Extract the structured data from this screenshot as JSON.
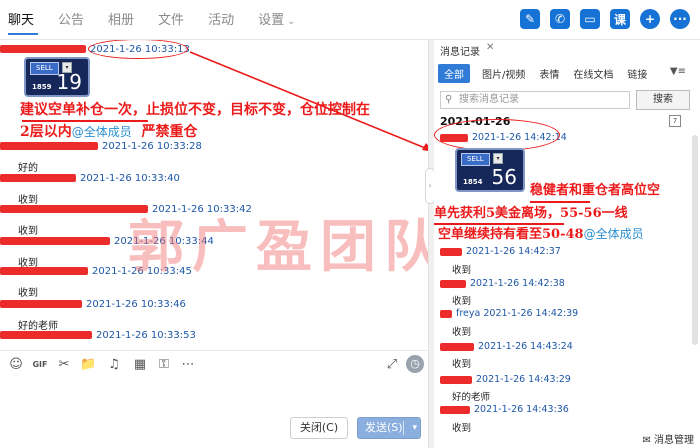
{
  "tabs": [
    {
      "label": "聊天"
    },
    {
      "label": "公告"
    },
    {
      "label": "相册"
    },
    {
      "label": "文件"
    },
    {
      "label": "活动"
    },
    {
      "label": "设置"
    }
  ],
  "top_icons": {
    "ke": "课",
    "plus": "+",
    "more": "···"
  },
  "chat": {
    "msg0_time": "2021-1-26 10:33:13",
    "card0": {
      "label": "SELL",
      "small": "1859",
      "big": "19"
    },
    "ann1_line1": "建议空单补仓一次，止损位不变，目标不变，仓位控制在",
    "ann1_line2_red": "2层以内",
    "ann1_line2_blue": "@全体成员",
    "ann1_line2_tail": "严禁重仓",
    "messages": [
      {
        "time": "2021-1-26 10:33:28",
        "text": "好的"
      },
      {
        "time": "2021-1-26 10:33:40",
        "text": "收到"
      },
      {
        "time": "2021-1-26 10:33:42",
        "text": "收到"
      },
      {
        "time": "2021-1-26 10:33:44",
        "text": "收到"
      },
      {
        "time": "2021-1-26 10:33:45",
        "text": "收到"
      },
      {
        "time": "2021-1-26 10:33:46",
        "text": "好的老师"
      },
      {
        "time": "2021-1-26 10:33:53",
        "text": "收到"
      }
    ],
    "watermark": "郭广盈团队"
  },
  "composer": {
    "close_label": "关闭(C)",
    "send_label": "发送(S)"
  },
  "history": {
    "title": "消息记录",
    "tabs": [
      "全部",
      "图片/视频",
      "表情",
      "在线文档",
      "链接"
    ],
    "search_placeholder": "搜索消息记录",
    "search_button": "搜索",
    "date": "2021-01-26",
    "first_time": "2021-1-26 14:42:14",
    "card1": {
      "label": "SELL",
      "small": "1854",
      "big": "56"
    },
    "ann2_line1": "稳健者和重仓者高位空",
    "ann2_line2": "单先获利5美金离场，55-56一线",
    "ann2_line3": "空单继续持有看至50-48",
    "ann2_line3_blue": "@全体成员",
    "messages": [
      {
        "time": "2021-1-26 14:42:37",
        "text": "收到",
        "sender": ""
      },
      {
        "time": "2021-1-26 14:42:38",
        "text": "收到",
        "sender": ""
      },
      {
        "time": "2021-1-26 14:42:39",
        "text": "收到",
        "sender": "freya"
      },
      {
        "time": "2021-1-26 14:43:24",
        "text": "收到",
        "sender": ""
      },
      {
        "time": "2021-1-26 14:43:29",
        "text": "好的老师",
        "sender": ""
      },
      {
        "time": "2021-1-26 14:43:36",
        "text": "收到",
        "sender": ""
      }
    ],
    "footer": "消息管理"
  },
  "colors": {
    "accent": "#2f7bd6",
    "annotation": "#ec1b1b",
    "timestamp": "#1d57a8",
    "mention": "#2c8fd0"
  }
}
